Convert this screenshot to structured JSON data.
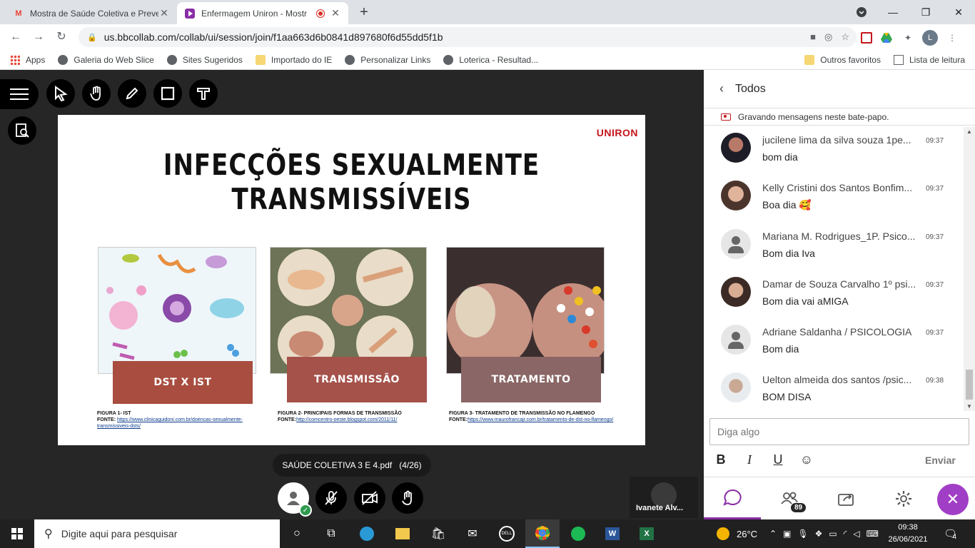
{
  "browser": {
    "tabs": [
      {
        "title": "Mostra de Saúde Coletiva e Preve",
        "favicon": "M"
      },
      {
        "title": "Enfermagem Uniron - Mostr"
      }
    ],
    "url": "us.bbcollab.com/collab/ui/session/join/f1aa663d6b0841d897680f6d55dd5f1b",
    "profile_initial": "L",
    "bookmarks": [
      "Apps",
      "Galeria do Web Slice",
      "Sites Sugeridos",
      "Importado do IE",
      "Personalizar Links",
      "Loterica - Resultad..."
    ],
    "bookmarks_right": [
      "Outros favoritos",
      "Lista de leitura"
    ]
  },
  "slide": {
    "logo": "UNIRON",
    "title": "INFECÇÕES SEXUALMENTE TRANSMISSÍVEIS",
    "banners": [
      "DST X IST",
      "TRANSMISSÃO",
      "TRATAMENTO"
    ],
    "captions": [
      {
        "label": "FIGURA 1- IST",
        "source_prefix": "FONTE:",
        "link": "https://www.clinicaguidoni.com.br/doencas-sexualmente-transmissiveis-dsts/"
      },
      {
        "label": "FIGURA 2- PRINCIPAIS FORMAS DE TRANSMISSÃO",
        "source_prefix": "FONTE:",
        "link": "http://comcentro-oeste.blogspot.com/2011/11/"
      },
      {
        "label": "FIGURA 3- TRATAMENTO DE TRANSMISSÃO NO FLAMENGO",
        "source_prefix": "FONTE:",
        "link": "https://www.maurofrancajr.com.br/tratamento-de-dst-no-flamengo/"
      }
    ]
  },
  "document": {
    "name": "SAÚDE COLETIVA 3 E 4.pdf",
    "page": "(4/26)"
  },
  "participant": {
    "name": "Ivanete Alv..."
  },
  "chat": {
    "title": "Todos",
    "recording_notice": "Gravando mensagens neste bate-papo.",
    "messages": [
      {
        "name": "jucilene lima da silva souza 1pe...",
        "time": "09:37",
        "text": "bom dia"
      },
      {
        "name": "Kelly Cristini dos Santos Bonfim...",
        "time": "09:37",
        "text": "Boa dia 🥰"
      },
      {
        "name": "Mariana M. Rodrigues_1P. Psico...",
        "time": "09:37",
        "text": "Bom dia Iva"
      },
      {
        "name": "Damar de Souza Carvalho 1º psi...",
        "time": "09:37",
        "text": "Bom dia vai aMIGA"
      },
      {
        "name": "Adriane Saldanha / PSICOLOGIA",
        "time": "09:37",
        "text": "Bom dia"
      },
      {
        "name": "Uelton almeida dos santos /psic...",
        "time": "09:38",
        "text": "BOM DISA"
      }
    ],
    "input_placeholder": "Diga algo",
    "send_label": "Enviar",
    "participant_count": "89"
  },
  "taskbar": {
    "search_placeholder": "Digite aqui para pesquisar",
    "weather": "26°C",
    "time": "09:38",
    "date": "26/06/2021",
    "notifications": "4"
  },
  "colors": {
    "accent": "#8a2ea6",
    "close_button": "#a13ec6",
    "uniron_red": "#c4161c"
  }
}
